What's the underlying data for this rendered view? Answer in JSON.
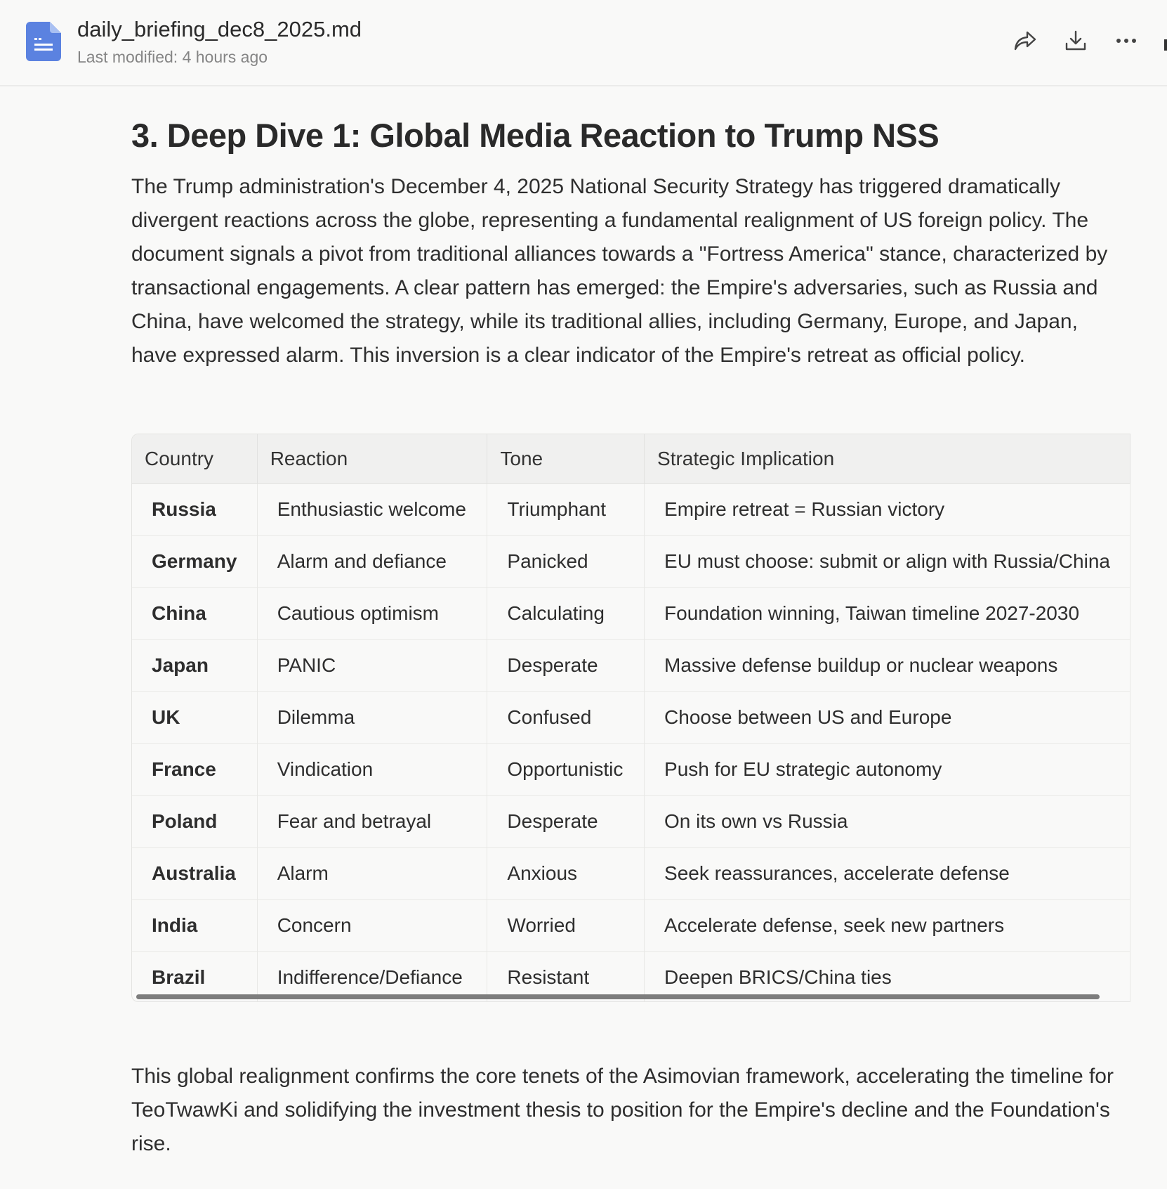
{
  "header": {
    "filename": "daily_briefing_dec8_2025.md",
    "modified": "Last modified: 4 hours ago",
    "icons": [
      "share-icon",
      "download-icon",
      "more-icon"
    ]
  },
  "heading": "3. Deep Dive 1: Global Media Reaction to Trump NSS",
  "intro": "The Trump administration's December 4, 2025 National Security Strategy has triggered dramatically divergent reactions across the globe, representing a fundamental realignment of US foreign policy. The document signals a pivot from traditional alliances towards a \"Fortress America\" stance, characterized by transactional engagements. A clear pattern has emerged: the Empire's adversaries, such as Russia and China, have welcomed the strategy, while its traditional allies, including Germany, Europe, and Japan, have expressed alarm. This inversion is a clear indicator of the Empire's retreat as official policy.",
  "table": {
    "headers": [
      "Country",
      "Reaction",
      "Tone",
      "Strategic Implication"
    ],
    "rows": [
      [
        "Russia",
        "Enthusiastic welcome",
        "Triumphant",
        "Empire retreat = Russian victory"
      ],
      [
        "Germany",
        "Alarm and defiance",
        "Panicked",
        "EU must choose: submit or align with Russia/China"
      ],
      [
        "China",
        "Cautious optimism",
        "Calculating",
        "Foundation winning, Taiwan timeline 2027-2030"
      ],
      [
        "Japan",
        "PANIC",
        "Desperate",
        "Massive defense buildup or nuclear weapons"
      ],
      [
        "UK",
        "Dilemma",
        "Confused",
        "Choose between US and Europe"
      ],
      [
        "France",
        "Vindication",
        "Opportunistic",
        "Push for EU strategic autonomy"
      ],
      [
        "Poland",
        "Fear and betrayal",
        "Desperate",
        "On its own vs Russia"
      ],
      [
        "Australia",
        "Alarm",
        "Anxious",
        "Seek reassurances, accelerate defense"
      ],
      [
        "India",
        "Concern",
        "Worried",
        "Accelerate defense, seek new partners"
      ],
      [
        "Brazil",
        "Indifference/Defiance",
        "Resistant",
        "Deepen BRICS/China ties"
      ]
    ]
  },
  "conclusion": "This global realignment confirms the core tenets of the Asimovian framework, accelerating the timeline for TeoTwawKi and solidifying the investment thesis to position for the Empire's decline and the Foundation's rise."
}
